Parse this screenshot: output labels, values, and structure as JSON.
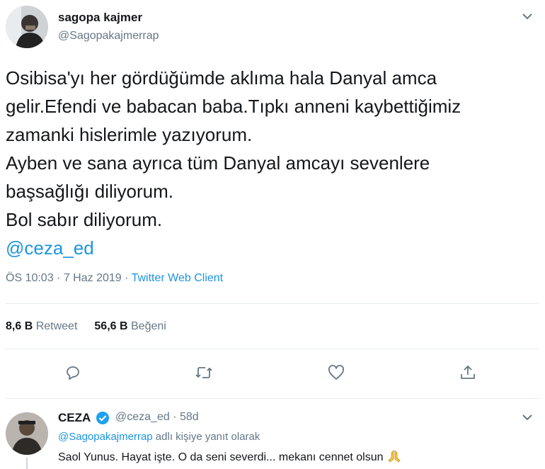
{
  "tweet": {
    "author_name": "sagopa kajmer",
    "author_handle": "@Sagopakajmerrap",
    "text_lines": [
      "Osibisa'yı her gördüğümde aklıma hala Danyal amca",
      "gelir.Efendi ve babacan baba.Tıpkı anneni kaybettiğimiz",
      "zamanki hislerimle yazıyorum.",
      "Ayben ve sana ayrıca tüm Danyal amcayı sevenlere",
      "başsağlığı diliyorum.",
      "Bol sabır diliyorum."
    ],
    "mention": "@ceza_ed",
    "timestamp": "ÖS 10:03 · 7 Haz 2019 · ",
    "client": "Twitter Web Client",
    "retweets_count": "8,6 B",
    "retweets_label": "Retweet",
    "likes_count": "56,6 B",
    "likes_label": "Beğeni",
    "icons": {
      "caret": "chevron-down-icon",
      "reply": "reply-icon",
      "retweet": "retweet-icon",
      "like": "heart-icon",
      "share": "share-icon"
    }
  },
  "reply": {
    "author_name": "CEZA",
    "verified": true,
    "author_handle_time": "@ceza_ed · 58d",
    "context_mention": "@Sagopakajmerrap",
    "context_text": " adlı kişiye yanıt olarak",
    "text": "Saol Yunus. Hayat işte. O da seni severdi... mekanı cennet olsun"
  },
  "colors": {
    "text": "#14171a",
    "secondary": "#657786",
    "link": "#1b95e0",
    "divider": "#e6ecf0"
  }
}
